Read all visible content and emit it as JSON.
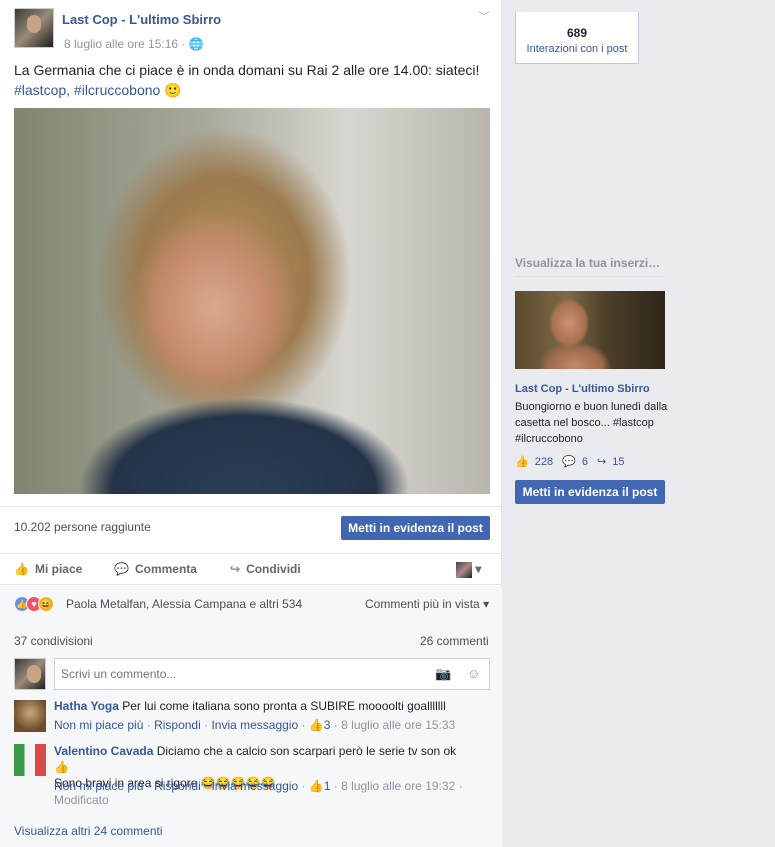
{
  "post": {
    "page_name": "Last Cop - L'ultimo Sbirro",
    "date": "8 luglio alle ore 15:16",
    "audience_icon": "globe-icon",
    "text": "La Germania che ci piace è in onda domani su Rai 2 alle ore 14.00: siateci!",
    "hashtags": "#lastcop, #ilcruccobono",
    "emoji": "🙂",
    "reach": "10.202 persone raggiunte",
    "boost_label": "Metti in evidenza il post"
  },
  "actions": {
    "like": "Mi piace",
    "comment": "Commenta",
    "share": "Condividi"
  },
  "ufi": {
    "likers": "Paola Metalfan, Alessia Campana e altri 534",
    "most_relevant": "Commenti più in vista",
    "shares": "37 condivisioni",
    "comments_count": "26 commenti",
    "composer_placeholder": "Scrivi un commento...",
    "view_more": "Visualizza altri 24 commenti"
  },
  "comments": [
    {
      "author": "Hatha Yoga",
      "text": "Per lui come italiana sono pronta a SUBIRE moooolti goalllllll",
      "unlike": "Non mi piace più",
      "reply": "Rispondi",
      "message": "Invia messaggio",
      "likes": "3",
      "time": "8 luglio alle ore 15:33"
    },
    {
      "author": "Valentino Cavada",
      "text": "Diciamo che a calcio son scarpari però le serie tv son ok",
      "text2": "Sono bravi in area si rigore",
      "emoji": "😂😂😂😂😂",
      "unlike": "Non mi piace più",
      "reply": "Rispondi",
      "message": "Invia messaggio",
      "likes": "1",
      "time": "8 luglio alle ore 19:32",
      "edited": "Modificato"
    }
  ],
  "sidebar": {
    "interactions_count": "689",
    "interactions_label": "Interazioni con i post",
    "promo_heading": "Visualizza la tua inserzio...",
    "promo_page": "Last Cop - L'ultimo Sbirro",
    "promo_text": "Buongiorno e buon lunedì dalla casetta nel bosco... #lastcop #ilcruccobono",
    "promo_likes": "228",
    "promo_comments": "6",
    "promo_shares": "15",
    "promo_button": "Metti in evidenza il post"
  },
  "colors": {
    "brand": "#4267b2",
    "link": "#365899",
    "muted": "#90949c"
  }
}
